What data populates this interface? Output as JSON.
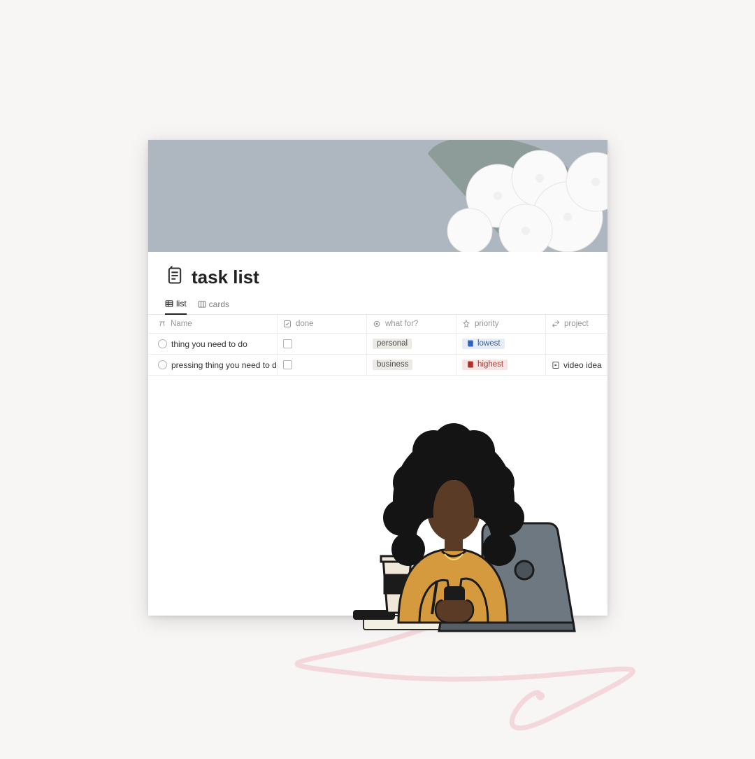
{
  "page": {
    "title": "task list",
    "icon": "scroll-list-icon"
  },
  "views": [
    {
      "icon": "table-icon",
      "label": "list",
      "active": true
    },
    {
      "icon": "board-icon",
      "label": "cards",
      "active": false
    }
  ],
  "columns": {
    "name": {
      "icon": "text-icon",
      "label": "Name"
    },
    "done": {
      "icon": "checkbox-icon",
      "label": "done"
    },
    "whatfor": {
      "icon": "tag-icon",
      "label": "what for?"
    },
    "priority": {
      "icon": "pin-icon",
      "label": "priority"
    },
    "project": {
      "icon": "relation-icon",
      "label": "project"
    }
  },
  "rows": [
    {
      "name": "thing you need to do",
      "done": false,
      "whatfor": {
        "label": "personal",
        "class": "personal"
      },
      "priority": {
        "label": "lowest",
        "class": "lowest",
        "book": "blue"
      },
      "project": null
    },
    {
      "name": "pressing thing you need to do",
      "done": false,
      "whatfor": {
        "label": "business",
        "class": "business"
      },
      "priority": {
        "label": "highest",
        "class": "highest",
        "book": "red"
      },
      "project": {
        "label": "video idea",
        "icon": "page-icon"
      }
    }
  ],
  "decor": {
    "cover": "white-flowers-photo",
    "illustration": "woman-working-at-laptop",
    "accent_stroke": "#f4d7da"
  }
}
